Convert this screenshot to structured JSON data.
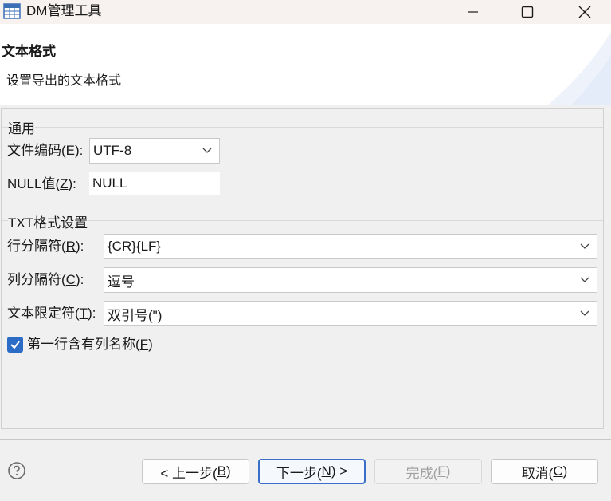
{
  "window": {
    "title": "DM管理工具",
    "icon": "table-grid-icon",
    "controls": [
      "minimize-icon",
      "maximize-icon",
      "close-icon"
    ]
  },
  "header": {
    "title": "文本格式",
    "description": "设置导出的文本格式"
  },
  "general": {
    "group_label": "通用",
    "encoding": {
      "label": "文件编码(",
      "mnemonic": "E",
      "label_end": "):",
      "value": "UTF-8"
    },
    "null_value": {
      "label": "NULL值(",
      "mnemonic": "Z",
      "label_end": "):",
      "value": "NULL"
    }
  },
  "txt_settings": {
    "group_label": "TXT格式设置",
    "row_separator": {
      "label": "行分隔符(",
      "mnemonic": "R",
      "label_end": "):",
      "value": "{CR}{LF}"
    },
    "col_separator": {
      "label": "列分隔符(",
      "mnemonic": "C",
      "label_end": "):",
      "value": "逗号"
    },
    "text_qualifier": {
      "label": "文本限定符(",
      "mnemonic": "T",
      "label_end": "):",
      "value": "双引号(\")"
    },
    "first_row_header": {
      "label": "第一行含有列名称(",
      "mnemonic": "F",
      "label_end": ")",
      "checked": true
    }
  },
  "footer": {
    "help_icon": "help-icon",
    "back": {
      "prefix": "< 上一步(",
      "mnemonic": "B",
      "suffix": ")"
    },
    "next": {
      "prefix": "下一步(",
      "mnemonic": "N",
      "suffix": ") >"
    },
    "finish": {
      "prefix": "完成(",
      "mnemonic": "F",
      "suffix": ")",
      "enabled": false
    },
    "cancel": {
      "prefix": "取消(",
      "mnemonic": "C",
      "suffix": ")"
    }
  },
  "colors": {
    "accent": "#2a6cc6",
    "default_button_border": "#3a6fc8",
    "titlebar_bg": "#f7f1ef"
  }
}
